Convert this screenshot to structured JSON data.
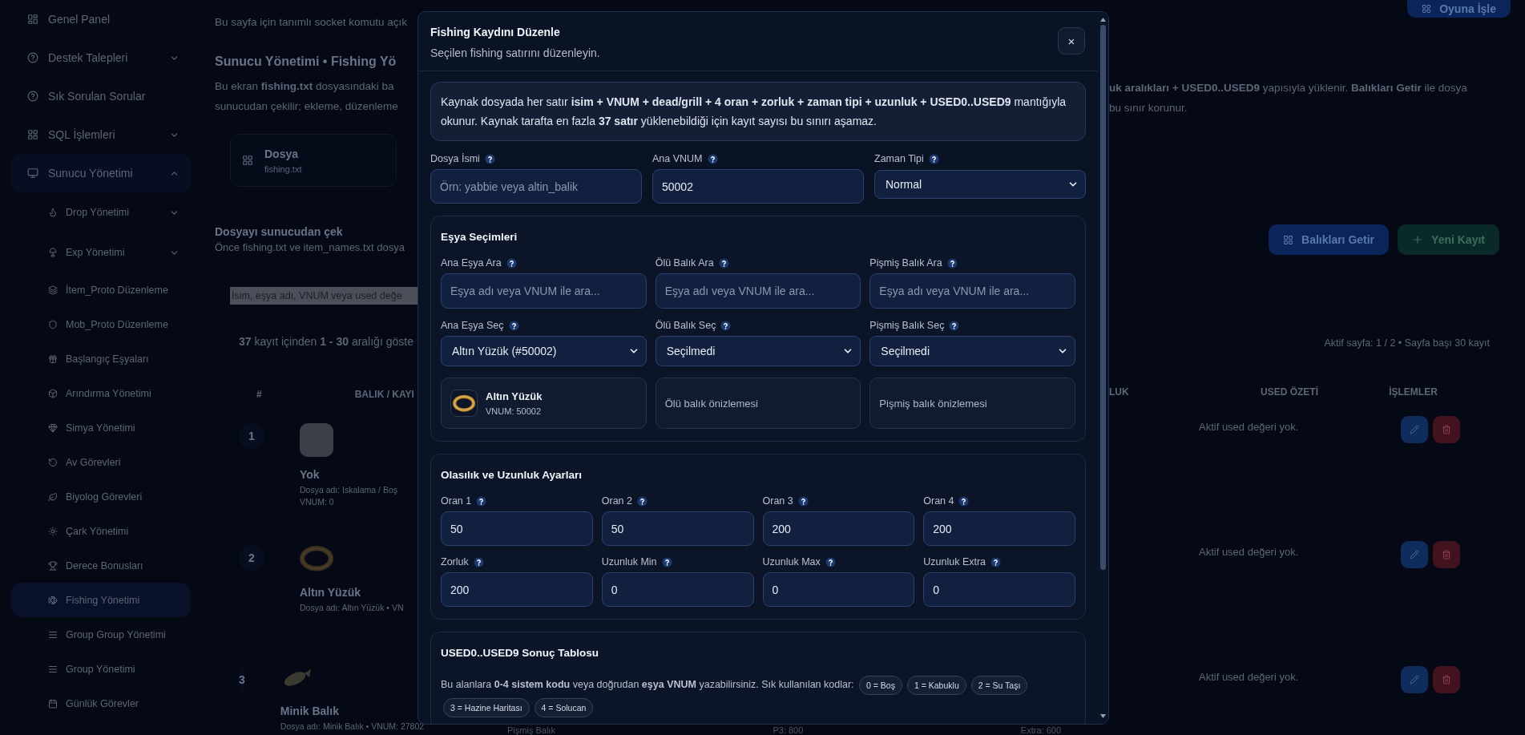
{
  "sidebar": {
    "items": [
      {
        "label": "Genel Panel",
        "selected": false
      },
      {
        "label": "Destek Talepleri",
        "selected": false,
        "expanded": false
      },
      {
        "label": "Sık Sorulan Sorular",
        "selected": false
      },
      {
        "label": "SQL İşlemleri",
        "selected": false,
        "expanded": false
      },
      {
        "label": "Sunucu Yönetimi",
        "selected": false,
        "expanded": true,
        "children": [
          {
            "label": "Drop Yönetimi",
            "selected": false,
            "expanded": false
          },
          {
            "label": "Exp Yönetimi",
            "selected": false,
            "expanded": false
          },
          {
            "label": "İtem_Proto Düzenleme",
            "selected": false
          },
          {
            "label": "Mob_Proto Düzenleme",
            "selected": false
          },
          {
            "label": "Başlangıç Eşyaları",
            "selected": false
          },
          {
            "label": "Arındırma Yönetimi",
            "selected": false
          },
          {
            "label": "Simya Yönetimi",
            "selected": false
          },
          {
            "label": "Av Görevleri",
            "selected": false
          },
          {
            "label": "Biyolog Görevleri",
            "selected": false
          },
          {
            "label": "Çark Yönetimi",
            "selected": false
          },
          {
            "label": "Derece Bonusları",
            "selected": false
          },
          {
            "label": "Fishing Yönetimi",
            "selected": true
          },
          {
            "label": "Group Group Yönetimi",
            "selected": false
          },
          {
            "label": "Group Yönetimi",
            "selected": false
          },
          {
            "label": "Günlük Görevler",
            "selected": false
          }
        ]
      }
    ]
  },
  "page": {
    "socket_note": "Bu sayfa için tanımlı socket komutu açık",
    "top_button": "Oyuna İşle",
    "intro": {
      "title": "Sunucu Yönetimi • Fishing Yö",
      "text_left": [
        "Bu ekran **fishing.txt** dosyasındaki ba",
        "sunucudan çekilir; ekleme, düzenleme"
      ],
      "text_right": [
        "**uk aralıkları + USED0..USED9** yapısıyla yüklenir. **Balıkları Getir** ile dosya",
        "bu sınır korunur."
      ]
    },
    "stat_card": {
      "label": "Dosya",
      "value": "fishing.txt"
    },
    "fetch": {
      "title": "Dosyayı sunucudan çek",
      "text": "Önce fishing.txt ve item_names.txt dosya"
    },
    "actions": [
      {
        "label": "Balıkları Getir",
        "kind": "primary"
      },
      {
        "label": "Yeni Kayıt",
        "kind": "success"
      }
    ],
    "search": {
      "value": "İsim, eşya adı, VNUM veya used değe"
    },
    "summary": "**37** kayıt içinden **1 - 30** aralığı göste",
    "page_info": "Aktif sayfa: 1 / 2 • Sayfa başı 30 kayıt",
    "columns": [
      "#",
      "BALIK / KAYI",
      "LUK",
      "USED ÖZETİ",
      "İŞLEMLER"
    ],
    "rows": [
      {
        "index": "1",
        "kind": "placeholder",
        "name": "Yok",
        "details": [
          "Dosya adı: Iskalama / Boş",
          "VNUM: 0"
        ],
        "used": "Aktif used değeri yok."
      },
      {
        "index": "2",
        "kind": "ring",
        "name": "Altın Yüzük",
        "details": [
          "Dosya adı: Altın Yüzük • VN"
        ],
        "used": "Aktif used değeri yok."
      },
      {
        "index": "3",
        "kind": "fish",
        "name": "Minik Balık",
        "details": [
          "Dosya adı: Minik Balık • VNUM: 27802"
        ],
        "used": "Aktif used değeri yok."
      }
    ],
    "peek": [
      "Pişmiş Balık",
      "P3: 800",
      "Extra: 600"
    ]
  },
  "modal": {
    "title": "Fishing Kaydını Düzenle",
    "subtitle": "Seçilen fishing satırını düzenleyin.",
    "close": "×",
    "info": "Kaynak dosyada her satır **isim + VNUM + dead/grill + 4 oran + zorluk + zaman tipi + uzunluk + USED0..USED9** mantığıyla okunur. Kaynak tarafta en fazla **37 satır** yüklenebildiği için kayıt sayısı bu sınırı aşamaz.",
    "fields": [
      {
        "kind": "input",
        "label": "Dosya İsmi",
        "placeholder": "Örn: yabbie veya altin_balik"
      },
      {
        "kind": "input",
        "label": "Ana VNUM",
        "value": "50002"
      },
      {
        "kind": "select",
        "label": "Zaman Tipi",
        "value": "Normal"
      }
    ],
    "items_section": {
      "title": "Eşya Seçimleri",
      "searches": [
        {
          "label": "Ana Eşya Ara",
          "placeholder": "Eşya adı veya VNUM ile ara..."
        },
        {
          "label": "Ölü Balık Ara",
          "placeholder": "Eşya adı veya VNUM ile ara..."
        },
        {
          "label": "Pişmiş Balık Ara",
          "placeholder": "Eşya adı veya VNUM ile ara..."
        }
      ],
      "selects": [
        {
          "label": "Ana Eşya Seç",
          "value": "Altın Yüzük (#50002)"
        },
        {
          "label": "Ölü Balık Seç",
          "value": "Seçilmedi"
        },
        {
          "label": "Pişmiş Balık Seç",
          "value": "Seçilmedi"
        }
      ],
      "previews": [
        {
          "kind": "item",
          "name": "Altın Yüzük",
          "vnum": "VNUM: 50002"
        },
        {
          "kind": "empty",
          "text": "Ölü balık önizlemesi"
        },
        {
          "kind": "empty",
          "text": "Pişmiş balık önizlemesi"
        }
      ]
    },
    "odds_section": {
      "title": "Olasılık ve Uzunluk Ayarları",
      "fields": [
        {
          "label": "Oran 1",
          "value": "50"
        },
        {
          "label": "Oran 2",
          "value": "50"
        },
        {
          "label": "Oran 3",
          "value": "200"
        },
        {
          "label": "Oran 4",
          "value": "200"
        },
        {
          "label": "Zorluk",
          "value": "200"
        },
        {
          "label": "Uzunluk Min",
          "value": "0"
        },
        {
          "label": "Uzunluk Max",
          "value": "0"
        },
        {
          "label": "Uzunluk Extra",
          "value": "0"
        }
      ]
    },
    "used_section": {
      "title": "USED0..USED9 Sonuç Tablosu",
      "text": "Bu alanlara **0-4 sistem kodu** veya doğrudan **eşya VNUM** yazabilirsiniz. Sık kullanılan kodlar:",
      "codes": [
        "0 = Boş",
        "1 = Kabuklu",
        "2 = Su Taşı",
        "3 = Hazine Haritası",
        "4 = Solucan"
      ]
    }
  }
}
